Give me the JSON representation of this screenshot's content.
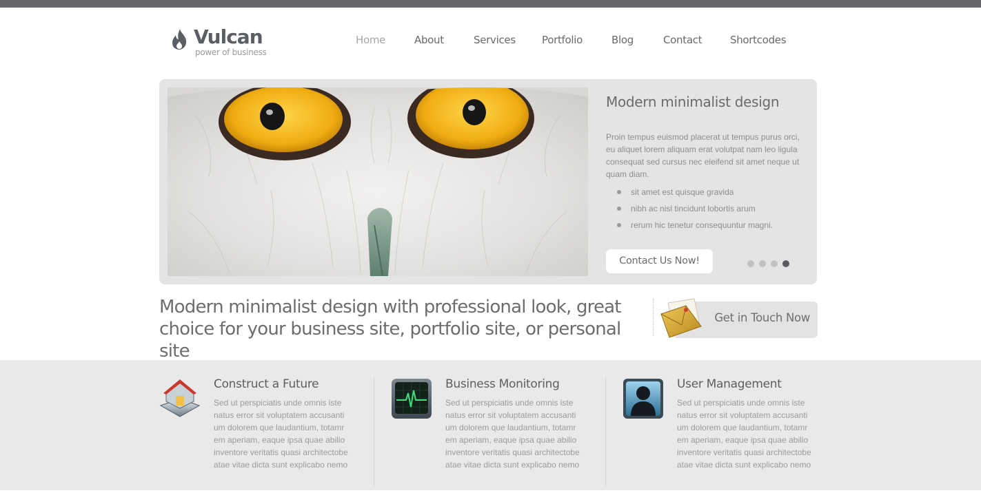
{
  "brand": {
    "name": "Vulcan",
    "tagline": "power of business"
  },
  "nav": {
    "items": [
      {
        "label": "Home",
        "active": true
      },
      {
        "label": "About"
      },
      {
        "label": "Services"
      },
      {
        "label": "Portfolio"
      },
      {
        "label": "Blog"
      },
      {
        "label": "Contact"
      },
      {
        "label": "Shortcodes"
      }
    ]
  },
  "slider": {
    "title": "Modern minimalist design",
    "body": "Proin tempus euismod placerat ut tempus purus orci, eu aliquet lorem aliquam erat volutpat nam leo ligula consequat sed cursus nec eleifend sit amet neque ut quam diam.",
    "bullets": [
      "sit amet est quisque gravida",
      "nibh ac nisl tincidunt lobortis arum",
      "rerum hic tenetur consequuntur magni."
    ],
    "cta": "Contact Us Now!",
    "slide_count": 4,
    "active_slide": 4
  },
  "tagline": "Modern minimalist design with professional look, great choice for your business site, portfolio site, or personal site",
  "get_in_touch": {
    "label": "Get in Touch Now",
    "icon": "envelope-icon"
  },
  "features": [
    {
      "title": "Construct a Future",
      "icon": "house-icon",
      "body": "Sed ut perspiciatis unde omnis iste natus error sit voluptatem accusanti um dolorem que laudantium, totamr em aperiam, eaque ipsa quae abillo inventore veritatis quasi architectobe atae vitae dicta sunt explicabo nemo"
    },
    {
      "title": "Business Monitoring",
      "icon": "monitor-icon",
      "body": "Sed ut perspiciatis unde omnis iste natus error sit voluptatem accusanti um dolorem que laudantium, totamr em aperiam, eaque ipsa quae abillo inventore veritatis quasi architectobe atae vitae dicta sunt explicabo nemo"
    },
    {
      "title": "User Management",
      "icon": "user-icon",
      "body": "Sed ut perspiciatis unde omnis iste natus error sit voluptatem accusanti um dolorem que laudantium, totamr em aperiam, eaque ipsa quae abillo inventore veritatis quasi architectobe atae vitae dicta sunt explicabo nemo"
    }
  ],
  "colors": {
    "topbar": "#64666b",
    "slider_bg": "#e4e4e4",
    "features_bg": "#e9e9e9",
    "owl_eye": "#f2b31c"
  }
}
